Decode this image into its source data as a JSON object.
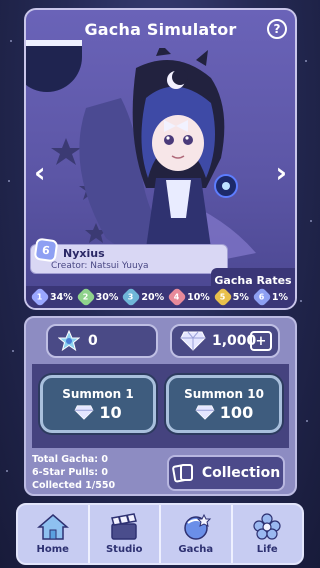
{
  "app": {
    "title": "Gacha Simulator",
    "help_glyph": "?"
  },
  "character": {
    "name": "Nyxius",
    "rank": "6",
    "creator": "Creator: Natsui Yuuya"
  },
  "navigation_arrows": {
    "prev": "‹",
    "next": "›"
  },
  "gacha_rates": {
    "label": "Gacha Rates",
    "rates": [
      {
        "star": "1",
        "value": "34%",
        "color": "#9aa7ff"
      },
      {
        "star": "2",
        "value": "30%",
        "color": "#8fd38c"
      },
      {
        "star": "3",
        "value": "20%",
        "color": "#6fb6d8"
      },
      {
        "star": "4",
        "value": "10%",
        "color": "#e88a9a"
      },
      {
        "star": "5",
        "value": "5%",
        "color": "#e8c04c"
      },
      {
        "star": "6",
        "value": "1%",
        "color": "#8ea0f3"
      }
    ]
  },
  "resources": {
    "coins": "0",
    "gems": "1,000"
  },
  "summon": {
    "single": {
      "label": "Summon 1",
      "cost": "10"
    },
    "multi": {
      "label": "Summon 10",
      "cost": "100"
    }
  },
  "stats": {
    "total_gacha": "Total Gacha: 0",
    "six_star_pulls": "6-Star Pulls: 0",
    "collected": "Collected 1/550"
  },
  "collection_button": "Collection",
  "nav": [
    {
      "label": "Home",
      "icon": "house-icon"
    },
    {
      "label": "Studio",
      "icon": "clapperboard-icon"
    },
    {
      "label": "Gacha",
      "icon": "gacha-orb-icon"
    },
    {
      "label": "Life",
      "icon": "flower-icon"
    }
  ]
}
